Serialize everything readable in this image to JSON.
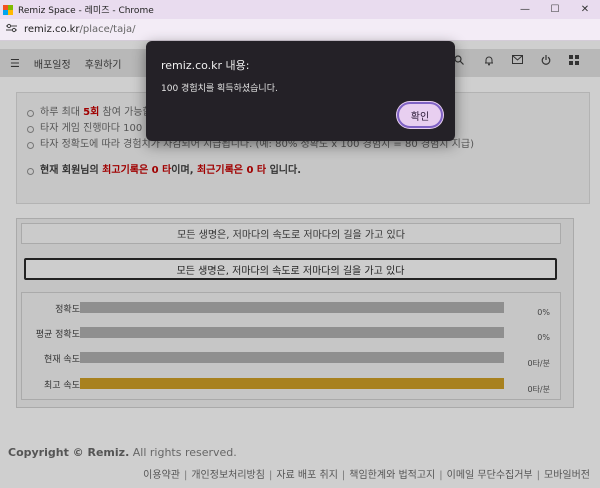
{
  "window": {
    "title": "Remiz Space - 레미즈 - Chrome",
    "controls": {
      "minimize": "—",
      "maximize": "☐",
      "close": "✕"
    }
  },
  "address": {
    "domain": "remiz.co.kr",
    "path": "/place/taja/"
  },
  "nav": {
    "menu_icon": "hamburger-icon",
    "items": [
      "배포일정",
      "후원하기"
    ],
    "right_icons": [
      "search-icon",
      "bell-icon",
      "mail-icon",
      "power-icon",
      "grid-icon"
    ]
  },
  "info": {
    "line1_pre": "하루 최대 ",
    "line1_highlight": "5회",
    "line1_post": " 참여 가능합",
    "line2": "타자 게임 진행마다 100",
    "line3": "타자 정확도에 따라 경험치가 차감되어 지급됩니다. (예: 80% 정확도 x 100 경험치 = 80 경험치 지급)",
    "line4_pre": "현재 회원님의 ",
    "line4_best": "최고기록은 0 타",
    "line4_mid": "이며, ",
    "line4_recent": "최근기록은 0 타",
    "line4_post": " 입니다."
  },
  "game": {
    "sentence": "모든 생명은, 저마다의 속도로 저마다의 길을 가고 있다",
    "typed_value": "모든 생명은, 저마다의 속도로 저마다의 길을 가고 있다",
    "stats": [
      {
        "label": "정확도",
        "value": "0%",
        "fill": 0
      },
      {
        "label": "평균 정확도",
        "value": "0%",
        "fill": 0
      },
      {
        "label": "현재 속도",
        "value": "0타/분",
        "fill": 0
      },
      {
        "label": "최고 속도",
        "value": "0타/분",
        "fill": 1
      }
    ]
  },
  "footer": {
    "copyright_pre": "Copyright © ",
    "copyright_brand": "Remiz.",
    "copyright_post": " All rights reserved.",
    "links": [
      "이용약관",
      "개인정보처리방침",
      "자료 배포 취지",
      "책임한계와 법적고지",
      "이메일 무단수집거부",
      "모바일버전"
    ]
  },
  "dialog": {
    "title": "remiz.co.kr 내용:",
    "message": "100 경험치를 획득하셨습니다.",
    "ok_label": "확인"
  },
  "colors": {
    "titlebar": "#e9dcef",
    "dialog_bg": "#242127",
    "ok_button": "#e8cff0",
    "ok_border": "#7f62c4",
    "highlight_red": "#a00000",
    "best_speed_bar": "#a8811f",
    "stat_bar": "#8f8f8f"
  }
}
